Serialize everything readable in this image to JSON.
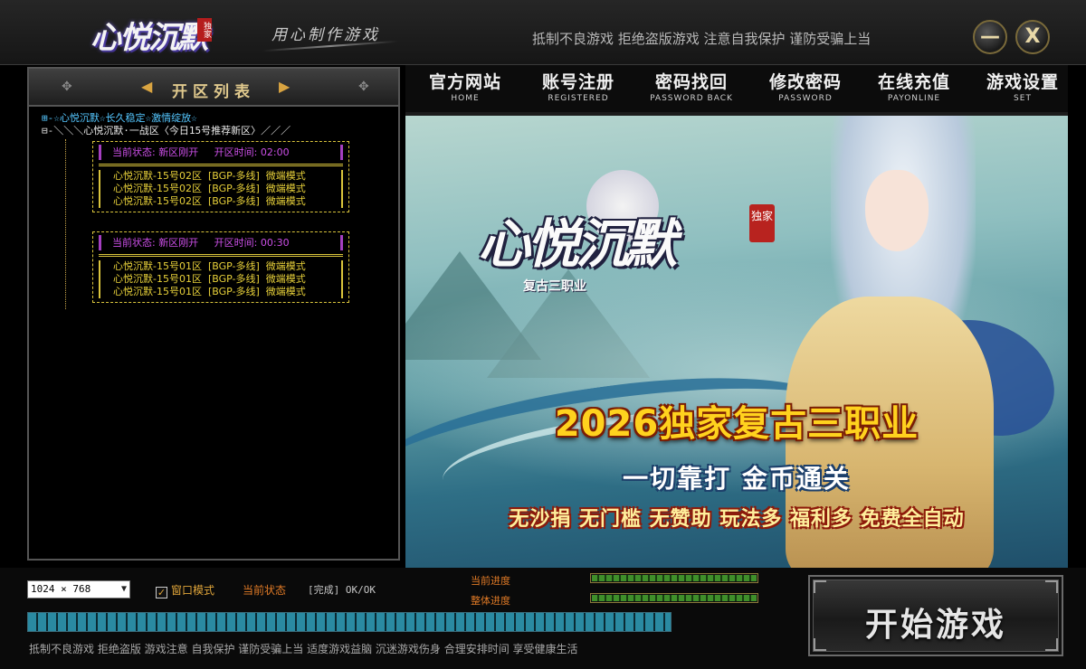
{
  "header": {
    "logo_text": "心悦沉默",
    "logo_seal": "独家",
    "slogan": "用心制作游戏",
    "notice": "抵制不良游戏  拒绝盗版游戏  注意自我保护  谨防受骗上当",
    "minimize_label": "—",
    "close_label": "X"
  },
  "server_panel": {
    "title": "开区列表",
    "prev_arrow": "◀",
    "next_arrow": "▶",
    "root_line": "⊞-☆心悦沉默☆长久稳定☆激情绽放☆",
    "sub_line": "⊟-＼＼＼心悦沉默·一战区〈今日15号推荐新区〉／／／",
    "groups": [
      {
        "status": "当前状态: 新区刚开     开区时间: 02:00",
        "servers": [
          "心悦沉默-15号02区  [BGP-多线]  微端模式",
          "心悦沉默-15号02区  [BGP-多线]  微端模式",
          "心悦沉默-15号02区  [BGP-多线]  微端模式"
        ]
      },
      {
        "status": "当前状态: 新区刚开     开区时间: 00:30",
        "servers": [
          "心悦沉默-15号01区  [BGP-多线]  微端模式",
          "心悦沉默-15号01区  [BGP-多线]  微端模式",
          "心悦沉默-15号01区  [BGP-多线]  微端模式"
        ]
      }
    ]
  },
  "nav": [
    {
      "cn": "官方网站",
      "en": "HOME"
    },
    {
      "cn": "账号注册",
      "en": "REGISTERED"
    },
    {
      "cn": "密码找回",
      "en": "PASSWORD BACK"
    },
    {
      "cn": "修改密码",
      "en": "PASSWORD"
    },
    {
      "cn": "在线充值",
      "en": "PAYONLINE"
    },
    {
      "cn": "游戏设置",
      "en": "SET"
    }
  ],
  "banner": {
    "logo": "心悦沉默",
    "seal": "独家",
    "logo_sub": "复古三职业",
    "headline": "2026独家复古三职业",
    "subline": "一切靠打 金币通关",
    "features": "无沙捐 无门槛 无赞助 玩法多 福利多 免费全自动"
  },
  "bottom": {
    "resolution": "1024 × 768",
    "window_mode_label": "窗口模式",
    "window_mode_checked": "✓",
    "status_label": "当前状态",
    "status_value": "[完成] OK/OK",
    "current_progress_label": "当前进度",
    "overall_progress_label": "整体进度",
    "current_progress": 1.0,
    "overall_progress": 1.0,
    "footer": "抵制不良游戏  拒绝盗版  游戏注意  自我保护  谨防受骗上当  适度游戏益脑  沉迷游戏伤身  合理安排时间  享受健康生活",
    "start_label": "开始游戏"
  },
  "colors": {
    "status_purple": "#cc4fe8",
    "server_yellow": "#e8d13a",
    "root_blue": "#55c7ff",
    "accent_orange": "#e07a26",
    "progress_green": "#3f8f2a",
    "loadbar_teal": "#2a8aa2"
  }
}
